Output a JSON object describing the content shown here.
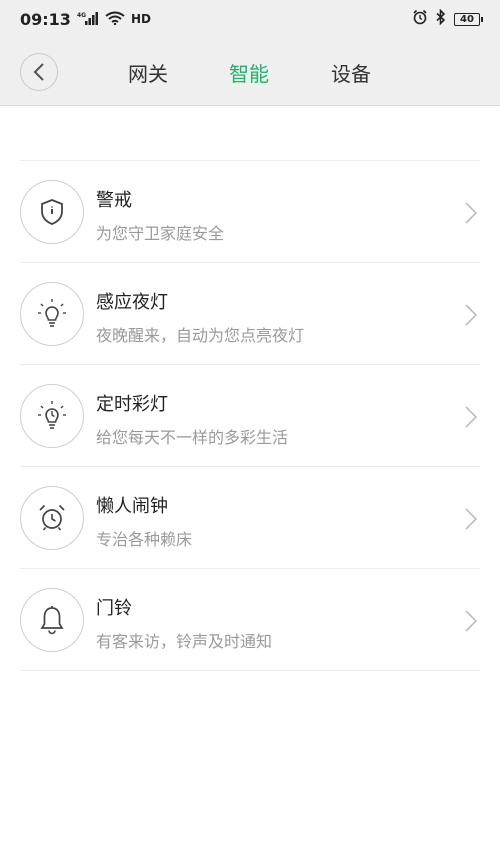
{
  "status_bar": {
    "time": "09:13",
    "signal_badge": "4G",
    "hd_label": "HD",
    "battery": "40"
  },
  "header": {
    "tabs": [
      {
        "label": "网关",
        "active": false
      },
      {
        "label": "智能",
        "active": true
      },
      {
        "label": "设备",
        "active": false
      }
    ]
  },
  "colors": {
    "accent": "#1fb36b",
    "subtitle": "#9a9a9a"
  },
  "items": [
    {
      "title": "警戒",
      "subtitle": "为您守卫家庭安全",
      "icon": "shield-icon"
    },
    {
      "title": "感应夜灯",
      "subtitle": "夜晚醒来，自动为您点亮夜灯",
      "icon": "bulb-icon"
    },
    {
      "title": "定时彩灯",
      "subtitle": "给您每天不一样的多彩生活",
      "icon": "timer-bulb-icon"
    },
    {
      "title": "懒人闹钟",
      "subtitle": "专治各种赖床",
      "icon": "alarm-clock-icon"
    },
    {
      "title": "门铃",
      "subtitle": "有客来访，铃声及时通知",
      "icon": "bell-icon"
    }
  ]
}
